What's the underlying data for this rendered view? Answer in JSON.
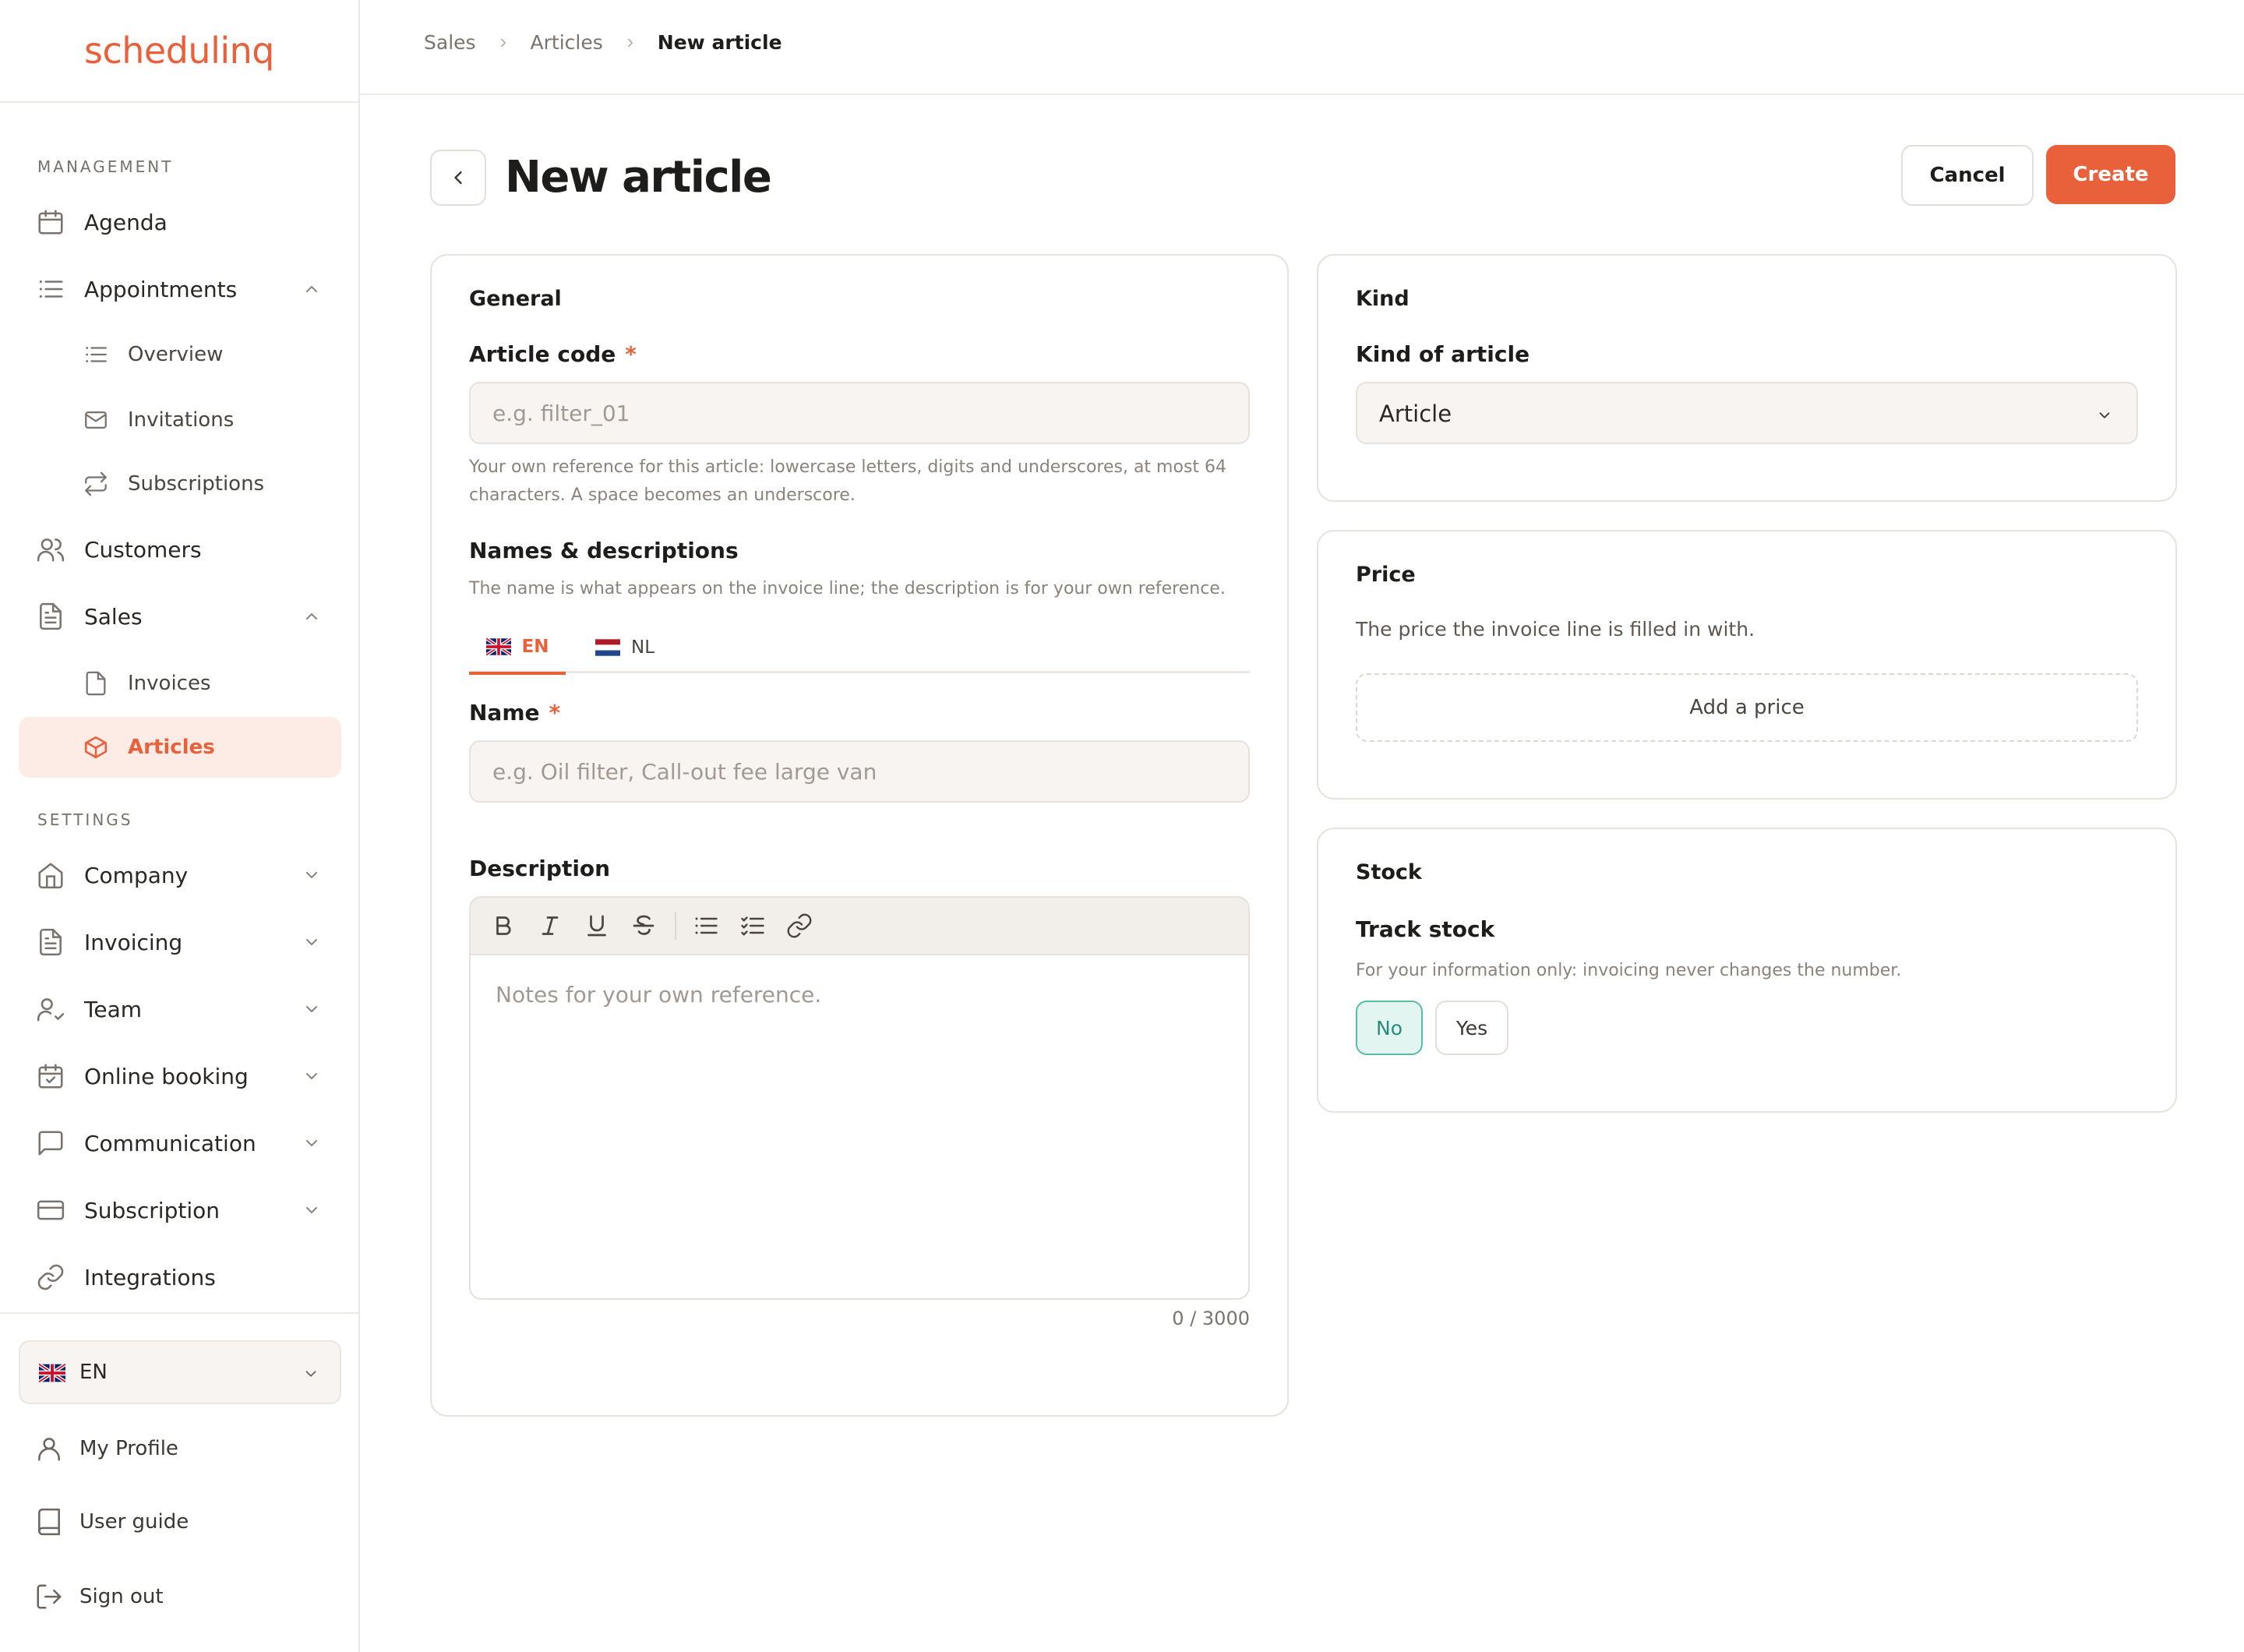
{
  "brand": {
    "name": "schedulinq",
    "color": "#e8613a"
  },
  "sidebar": {
    "management_label": "MANAGEMENT",
    "settings_label": "SETTINGS",
    "items": {
      "agenda": "Agenda",
      "appointments": "Appointments",
      "overview": "Overview",
      "invitations": "Invitations",
      "subscriptions": "Subscriptions",
      "customers": "Customers",
      "sales": "Sales",
      "invoices": "Invoices",
      "articles": "Articles",
      "company": "Company",
      "invoicing": "Invoicing",
      "team": "Team",
      "online_booking": "Online booking",
      "communication": "Communication",
      "subscription": "Subscription",
      "integrations": "Integrations"
    },
    "language": "EN",
    "footer": {
      "my_profile": "My Profile",
      "user_guide": "User guide",
      "sign_out": "Sign out"
    }
  },
  "breadcrumb": [
    "Sales",
    "Articles",
    "New article"
  ],
  "header": {
    "title": "New article",
    "cancel": "Cancel",
    "create": "Create"
  },
  "general": {
    "title": "General",
    "article_code_label": "Article code",
    "required_mark": "*",
    "article_code_placeholder": "e.g. filter_01",
    "article_code_help_1": "Your own reference for this article: lowercase letters, digits and underscores, at most 64",
    "article_code_help_2": "characters. A space becomes an underscore.",
    "names_title": "Names & descriptions",
    "names_help": "The name is what appears on the invoice line; the description is for your own reference.",
    "tabs": [
      "EN",
      "NL"
    ],
    "name_label": "Name",
    "name_placeholder": "e.g. Oil filter, Call-out fee large van",
    "description_label": "Description",
    "description_placeholder": "Notes for your own reference.",
    "counter": "0 / 3000"
  },
  "kind": {
    "title": "Kind",
    "label": "Kind of article",
    "value": "Article"
  },
  "price": {
    "title": "Price",
    "help": "The price the invoice line is filled in with.",
    "add": "Add a price"
  },
  "stock": {
    "title": "Stock",
    "label": "Track stock",
    "help": "For your information only: invoicing never changes the number.",
    "no": "No",
    "yes": "Yes"
  },
  "colors": {
    "accent": "#e8613a",
    "active_bg": "#fdece5",
    "toggle_on": "#2a8c77"
  },
  "icons": {
    "agenda": "calendar-icon",
    "appointments": "list-icon",
    "overview": "list-icon",
    "invitations": "mail-icon",
    "subscriptions": "repeat-icon",
    "customers": "users-icon",
    "sales": "document-icon",
    "invoices": "file-icon",
    "articles": "box-icon",
    "company": "home-icon",
    "invoicing": "document-icon",
    "team": "user-check-icon",
    "online_booking": "calendar-check-icon",
    "communication": "message-icon",
    "subscription": "credit-card-icon",
    "integrations": "link-icon",
    "my_profile": "user-icon",
    "user_guide": "book-icon",
    "sign_out": "logout-icon"
  }
}
